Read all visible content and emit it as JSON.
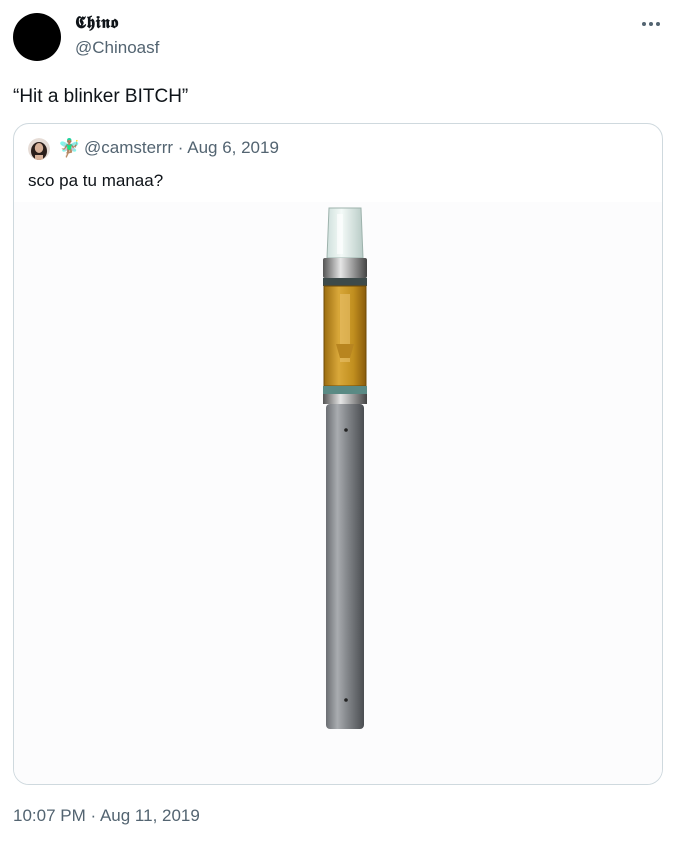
{
  "author": {
    "display_name": "𝕮𝖍𝖎𝖓𝖔",
    "handle": "@Chinoasf"
  },
  "tweet": {
    "text": "“Hit a blinker BITCH”",
    "time": "10:07 PM",
    "date": "Aug 11, 2019"
  },
  "quoted_tweet": {
    "emoji": "🧚🏽‍♂️",
    "handle": "@camsterrr",
    "date": "Aug 6, 2019",
    "text": "sco pa tu manaa?",
    "media_subject": "vape-pen"
  },
  "icons": {
    "more": "more-dots-icon"
  },
  "colors": {
    "text": "#0f1419",
    "secondary": "#536471",
    "border": "#cfd9de",
    "oil": "#c8961e"
  }
}
